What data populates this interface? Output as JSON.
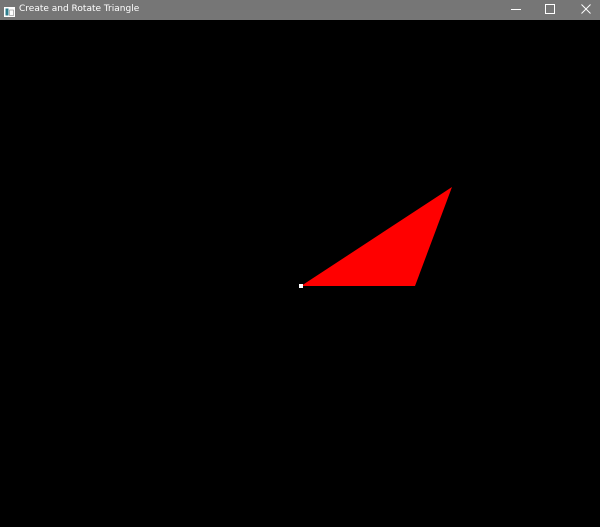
{
  "window": {
    "title": "Create and Rotate Triangle",
    "title_bar_color": "#767676",
    "title_text_color": "#ffffff"
  },
  "controls": {
    "minimize_icon": "minimize-icon",
    "maximize_icon": "maximize-icon",
    "close_icon": "close-icon"
  },
  "canvas": {
    "background": "#000000",
    "triangle_fill": "#ff0000",
    "vertex_marker_color": "#ffffff"
  }
}
